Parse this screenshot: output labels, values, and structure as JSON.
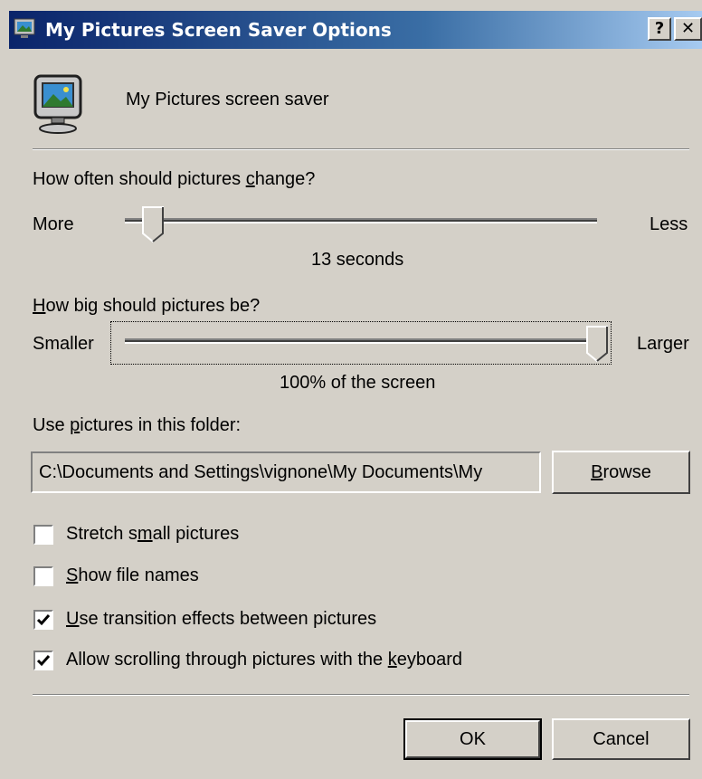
{
  "window": {
    "title": "My Pictures Screen Saver Options",
    "help_glyph": "?",
    "close_glyph": "✕"
  },
  "header": {
    "text": "My Pictures screen saver"
  },
  "change": {
    "question_pre": "How often should pictures ",
    "question_u": "c",
    "question_post": "hange?",
    "left_label": "More",
    "right_label": "Less",
    "value_text": "13 seconds",
    "slider_fraction": 0.06
  },
  "size": {
    "question_u": "H",
    "question_post": "ow big should pictures be?",
    "left_label": "Smaller",
    "right_label": "Larger",
    "value_text": "100% of the screen",
    "slider_fraction": 1.0
  },
  "folder": {
    "label_pre": "Use ",
    "label_u": "p",
    "label_post": "ictures in this folder:",
    "path": "C:\\Documents and Settings\\vignone\\My Documents\\My",
    "browse_u": "B",
    "browse_post": "rowse"
  },
  "options": [
    {
      "pre": "Stretch s",
      "u": "m",
      "post": "all pictures",
      "checked": false
    },
    {
      "pre": "",
      "u": "S",
      "post": "how file names",
      "checked": false
    },
    {
      "pre": "",
      "u": "U",
      "post": "se transition effects between pictures",
      "checked": true
    },
    {
      "pre": "Allow scrolling through pictures with the ",
      "u": "k",
      "post": "eyboard",
      "checked": true
    }
  ],
  "buttons": {
    "ok": "OK",
    "cancel": "Cancel"
  },
  "icons": {
    "app": "monitor-pictures-icon",
    "check": "checkmark-icon"
  },
  "colors": {
    "title_start": "#0a246a",
    "title_end": "#a6caf0",
    "face": "#d4d0c8"
  }
}
